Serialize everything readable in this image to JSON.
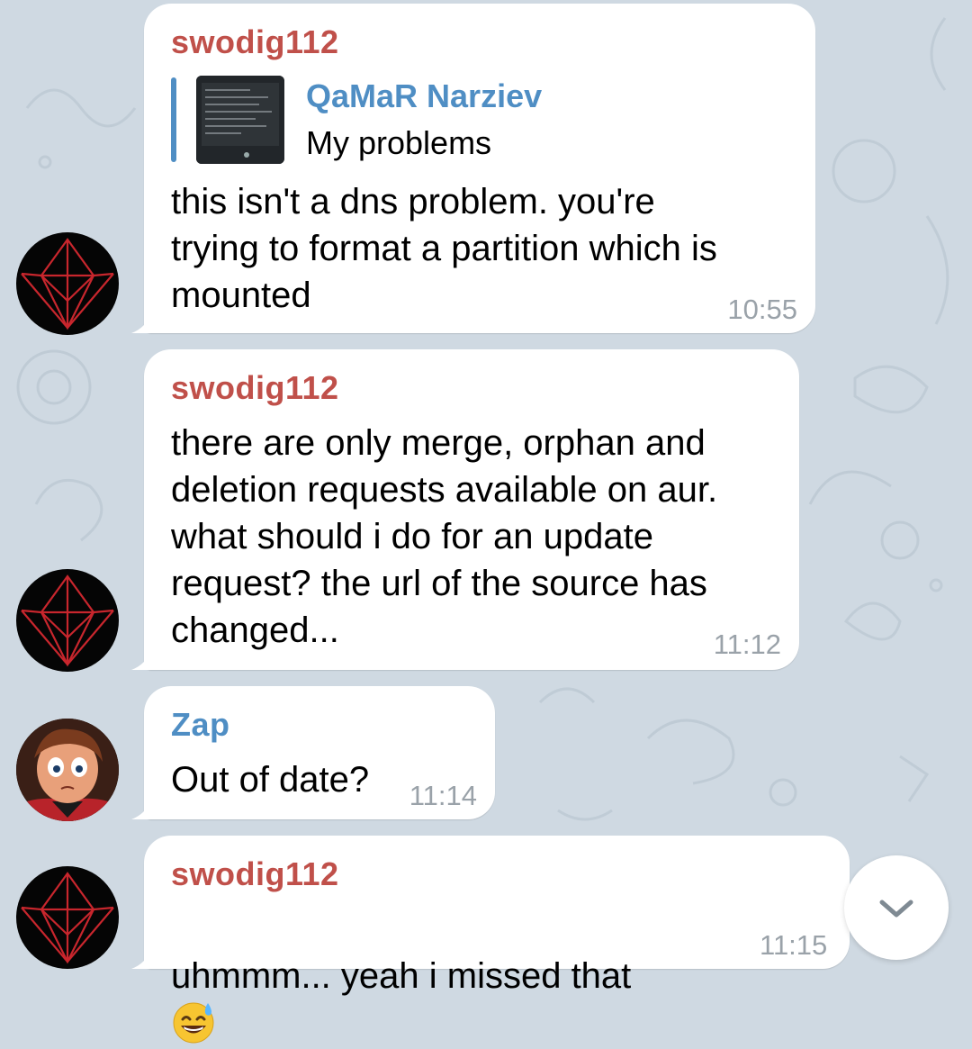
{
  "messages": [
    {
      "sender": "swodig112",
      "reply": {
        "name": "QaMaR Narziev",
        "text": "My problems"
      },
      "text": "this isn't a dns problem. you're\ntrying to format a partition which is\nmounted",
      "time": "10:55"
    },
    {
      "sender": "swodig112",
      "text": "there are only merge, orphan and\ndeletion requests available on aur.\nwhat should i do for an update\nrequest? the url of the source has\nchanged...",
      "time": "11:12"
    },
    {
      "sender": "Zap",
      "text": "Out of date?",
      "time": "11:14"
    },
    {
      "sender": "swodig112",
      "text": "uhmmm... yeah i missed that",
      "emoji": "grinning-sweat-emoji",
      "time": "11:15"
    }
  ],
  "icons": {
    "scroll_down": "chevron-down-icon"
  },
  "colors": {
    "background": "#cfd9e2",
    "sender_red": "#c0504a",
    "sender_blue": "#4f8ec4",
    "time": "#9aa2a9"
  }
}
